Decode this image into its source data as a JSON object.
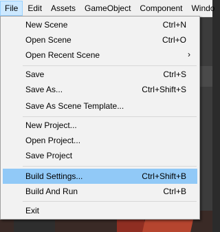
{
  "menubar": {
    "items": [
      {
        "label": "File"
      },
      {
        "label": "Edit"
      },
      {
        "label": "Assets"
      },
      {
        "label": "GameObject"
      },
      {
        "label": "Component"
      },
      {
        "label": "Windo"
      }
    ]
  },
  "file_menu": {
    "new_scene": {
      "label": "New Scene",
      "shortcut": "Ctrl+N"
    },
    "open_scene": {
      "label": "Open Scene",
      "shortcut": "Ctrl+O"
    },
    "open_recent_scene": {
      "label": "Open Recent Scene",
      "submenu_arrow": "›"
    },
    "save": {
      "label": "Save",
      "shortcut": "Ctrl+S"
    },
    "save_as": {
      "label": "Save As...",
      "shortcut": "Ctrl+Shift+S"
    },
    "save_as_scene_template": {
      "label": "Save As Scene Template..."
    },
    "new_project": {
      "label": "New Project..."
    },
    "open_project": {
      "label": "Open Project..."
    },
    "save_project": {
      "label": "Save Project"
    },
    "build_settings": {
      "label": "Build Settings...",
      "shortcut": "Ctrl+Shift+B",
      "highlighted": true
    },
    "build_and_run": {
      "label": "Build And Run",
      "shortcut": "Ctrl+B"
    },
    "exit": {
      "label": "Exit"
    }
  },
  "colors": {
    "menu_bg": "#f2f2f2",
    "highlight": "#91c9f7",
    "menubar_active": "#cce8ff"
  }
}
